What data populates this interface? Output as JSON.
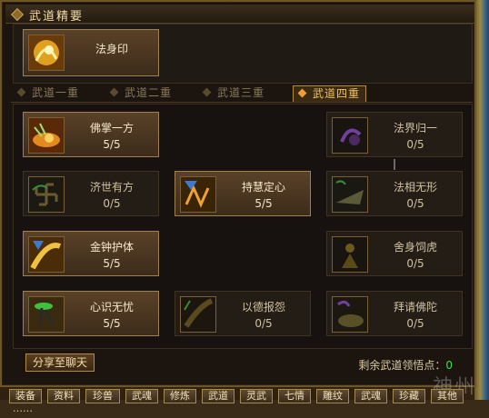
{
  "window": {
    "title": "武道精要"
  },
  "top_skill": {
    "name": "法身印"
  },
  "tabs": [
    {
      "label": "武道一重"
    },
    {
      "label": "武道二重"
    },
    {
      "label": "武道三重"
    },
    {
      "label": "武道四重",
      "active": true
    }
  ],
  "nodes": [
    {
      "name": "佛掌一方",
      "level": "5/5",
      "icon": "flame-palm-icon",
      "state": "lit"
    },
    {
      "name": "法界归一",
      "level": "0/5",
      "icon": "purple-swirl-icon",
      "state": "dim"
    },
    {
      "name": "济世有方",
      "level": "0/5",
      "icon": "swastika-icon",
      "state": "dim"
    },
    {
      "name": "持慧定心",
      "level": "5/5",
      "icon": "shield-rune-icon",
      "state": "lit"
    },
    {
      "name": "法相无形",
      "level": "0/5",
      "icon": "wing-buddha-icon",
      "state": "dim"
    },
    {
      "name": "金钟护体",
      "level": "5/5",
      "icon": "golden-bell-icon",
      "state": "lit"
    },
    {
      "name": "舍身饲虎",
      "level": "0/5",
      "icon": "monk-figure-icon",
      "state": "dim"
    },
    {
      "name": "心识无忧",
      "level": "5/5",
      "icon": "mind-staff-icon",
      "state": "lit"
    },
    {
      "name": "以德报怨",
      "level": "0/5",
      "icon": "dark-light-icon",
      "state": "dim"
    },
    {
      "name": "拜请佛陀",
      "level": "0/5",
      "icon": "lotus-buddha-icon",
      "state": "dim"
    }
  ],
  "share_button": "分享至聊天",
  "points": {
    "label": "剩余武道领悟点：",
    "value": "0"
  },
  "menu": [
    "装备",
    "资料",
    "珍兽",
    "武魂",
    "修炼",
    "武道",
    "灵武",
    "七情",
    "雕纹",
    "武魂",
    "珍藏",
    "其他"
  ],
  "watermark": "神州",
  "bottom_text": "……"
}
